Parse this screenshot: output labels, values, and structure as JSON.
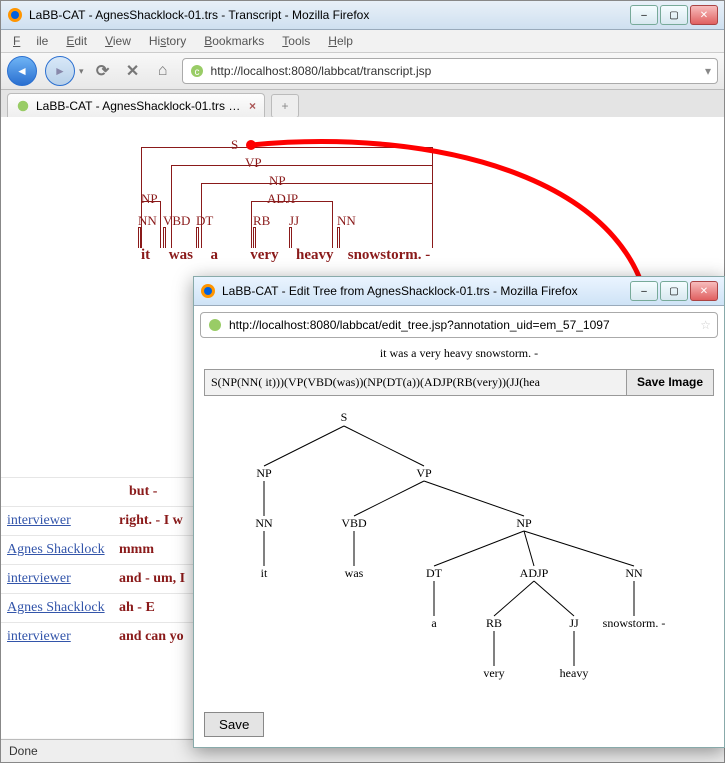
{
  "main_window": {
    "title": "LaBB-CAT - AgnesShacklock-01.trs - Transcript - Mozilla Firefox",
    "menu": {
      "file": "File",
      "edit": "Edit",
      "view": "View",
      "history": "History",
      "bookmarks": "Bookmarks",
      "tools": "Tools",
      "help": "Help"
    },
    "url": "http://localhost:8080/labbcat/transcript.jsp",
    "tab_label": "LaBB-CAT - AgnesShacklock-01.trs - ...",
    "status": "Done"
  },
  "parse_tree_top": {
    "labels": {
      "S": "S",
      "VP": "VP",
      "NP_top": "NP",
      "NP_left": "NP",
      "NN_left": "NN",
      "VBD": "VBD",
      "DT": "DT",
      "ADJP": "ADJP",
      "RB": "RB",
      "JJ": "JJ",
      "NN_right": "NN"
    },
    "words": {
      "it": "it",
      "was": "was",
      "a": "a",
      "very": "very",
      "heavy": "heavy",
      "snowstorm": "snowstorm. -"
    }
  },
  "transcript": [
    {
      "speaker": "",
      "text": "but - "
    },
    {
      "speaker": "interviewer",
      "text": "right. - I w"
    },
    {
      "speaker": "Agnes Shacklock",
      "text": "mmm"
    },
    {
      "speaker": "interviewer",
      "text": "and - um, I"
    },
    {
      "speaker": "Agnes Shacklock",
      "text": "ah - E"
    },
    {
      "speaker": "interviewer",
      "text": "and can yo"
    }
  ],
  "popup": {
    "title": "LaBB-CAT - Edit Tree from AgnesShacklock-01.trs - Mozilla Firefox",
    "url": "http://localhost:8080/labbcat/edit_tree.jsp?annotation_uid=em_57_1097",
    "sentence": "it was a very heavy snowstorm. -",
    "expr": "S(NP(NN( it)))(VP(VBD(was))(NP(DT(a))(ADJP(RB(very))(JJ(hea",
    "save_image": "Save Image",
    "save": "Save",
    "tree": {
      "S": "S",
      "NP": "NP",
      "VP": "VP",
      "NN": "NN",
      "VBD": "VBD",
      "NP2": "NP",
      "it": "it",
      "was": "was",
      "DT": "DT",
      "ADJP": "ADJP",
      "NN2": "NN",
      "a": "a",
      "RB": "RB",
      "JJ": "JJ",
      "snow": "snowstorm. -",
      "very": "very",
      "heavy": "heavy"
    }
  }
}
